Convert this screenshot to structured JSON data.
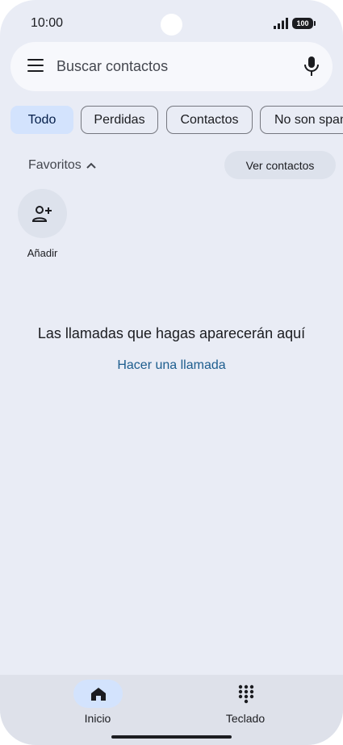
{
  "status_bar": {
    "time": "10:00",
    "battery": "100"
  },
  "search": {
    "placeholder": "Buscar contactos"
  },
  "filters": [
    {
      "label": "Todo",
      "selected": true
    },
    {
      "label": "Perdidas",
      "selected": false
    },
    {
      "label": "Contactos",
      "selected": false
    },
    {
      "label": "No son spam",
      "selected": false
    }
  ],
  "favorites": {
    "label": "Favoritos",
    "view_contacts_label": "Ver contactos",
    "add_label": "Añadir"
  },
  "empty_state": {
    "message": "Las llamadas que hagas aparecerán aquí",
    "action_label": "Hacer una llamada"
  },
  "bottom_nav": {
    "items": [
      {
        "label": "Inicio",
        "icon": "home-icon",
        "active": true
      },
      {
        "label": "Teclado",
        "icon": "dialpad-icon",
        "active": false
      }
    ]
  },
  "colors": {
    "background": "#e9ecf5",
    "selected_chip": "#d3e3fd",
    "link": "#1d5d8e"
  }
}
